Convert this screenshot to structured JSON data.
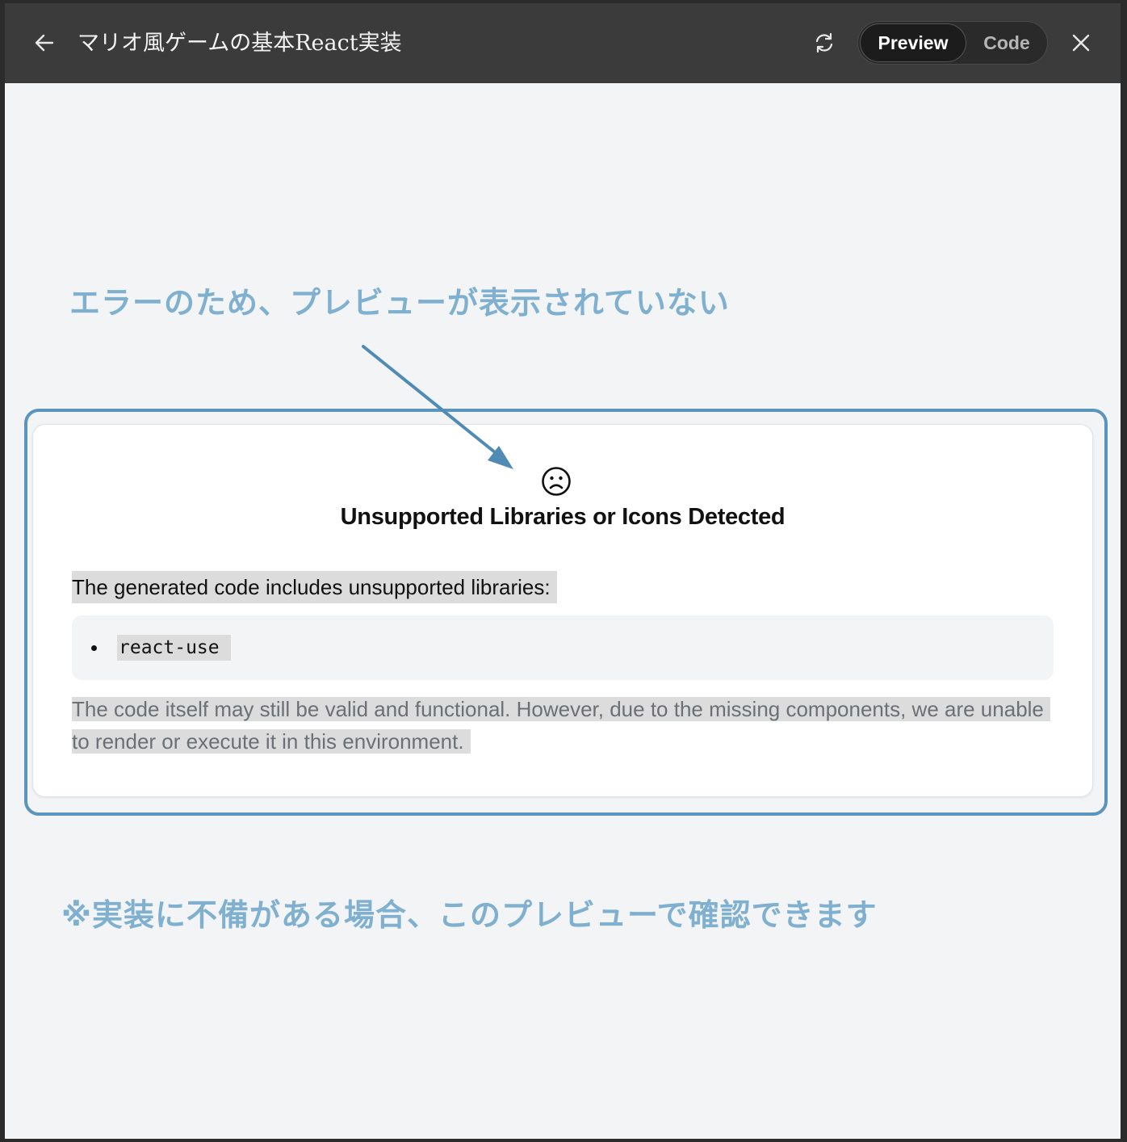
{
  "header": {
    "title": "マリオ風ゲームの基本React実装",
    "back_icon": "arrow-left-icon",
    "refresh_icon": "refresh-icon",
    "close_icon": "close-icon",
    "toggle": {
      "preview_label": "Preview",
      "code_label": "Code",
      "selected": "Preview"
    }
  },
  "annotations": {
    "top_note": "エラーのため、プレビューが表示されていない",
    "bottom_note": "※実装に不備がある場合、このプレビューで確認できます",
    "color": "#7fb0cf",
    "frame_color": "#5b95bd"
  },
  "error_card": {
    "icon": "sad-face-icon",
    "title": "Unsupported Libraries or Icons Detected",
    "intro": "The generated code includes unsupported libraries:",
    "libraries": [
      "react-use"
    ],
    "note": "The code itself may still be valid and functional. However, due to the missing components, we are unable to render or execute it in this environment."
  }
}
